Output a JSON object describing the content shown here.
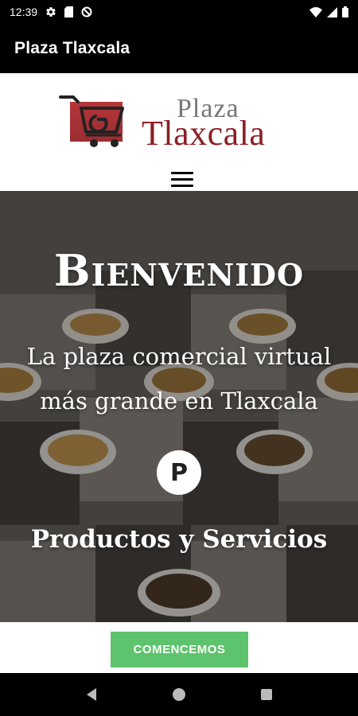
{
  "status_bar": {
    "time": "12:39",
    "icons": [
      "gear-icon",
      "sim-icon",
      "no-data-icon",
      "wifi-icon",
      "signal-icon",
      "battery-icon"
    ]
  },
  "app_bar": {
    "title": "Plaza Tlaxcala"
  },
  "site": {
    "logo": {
      "line1": "Plaza",
      "line2": "Tlaxcala"
    },
    "menu_icon": "hamburger-menu-icon"
  },
  "hero": {
    "title": "Bienvenido",
    "subtitle_line1": "La plaza comercial virtual",
    "subtitle_line2": "más grande en Tlaxcala",
    "badge_letter": "P",
    "services": "Productos y Servicios"
  },
  "cta": {
    "label": "COMENCEMOS",
    "color": "#5dc36c"
  },
  "colors": {
    "brand_red": "#8b1f25",
    "logo_gray": "#777777"
  },
  "nav_bar": {
    "buttons": [
      "back-icon",
      "home-icon",
      "recents-icon"
    ]
  }
}
